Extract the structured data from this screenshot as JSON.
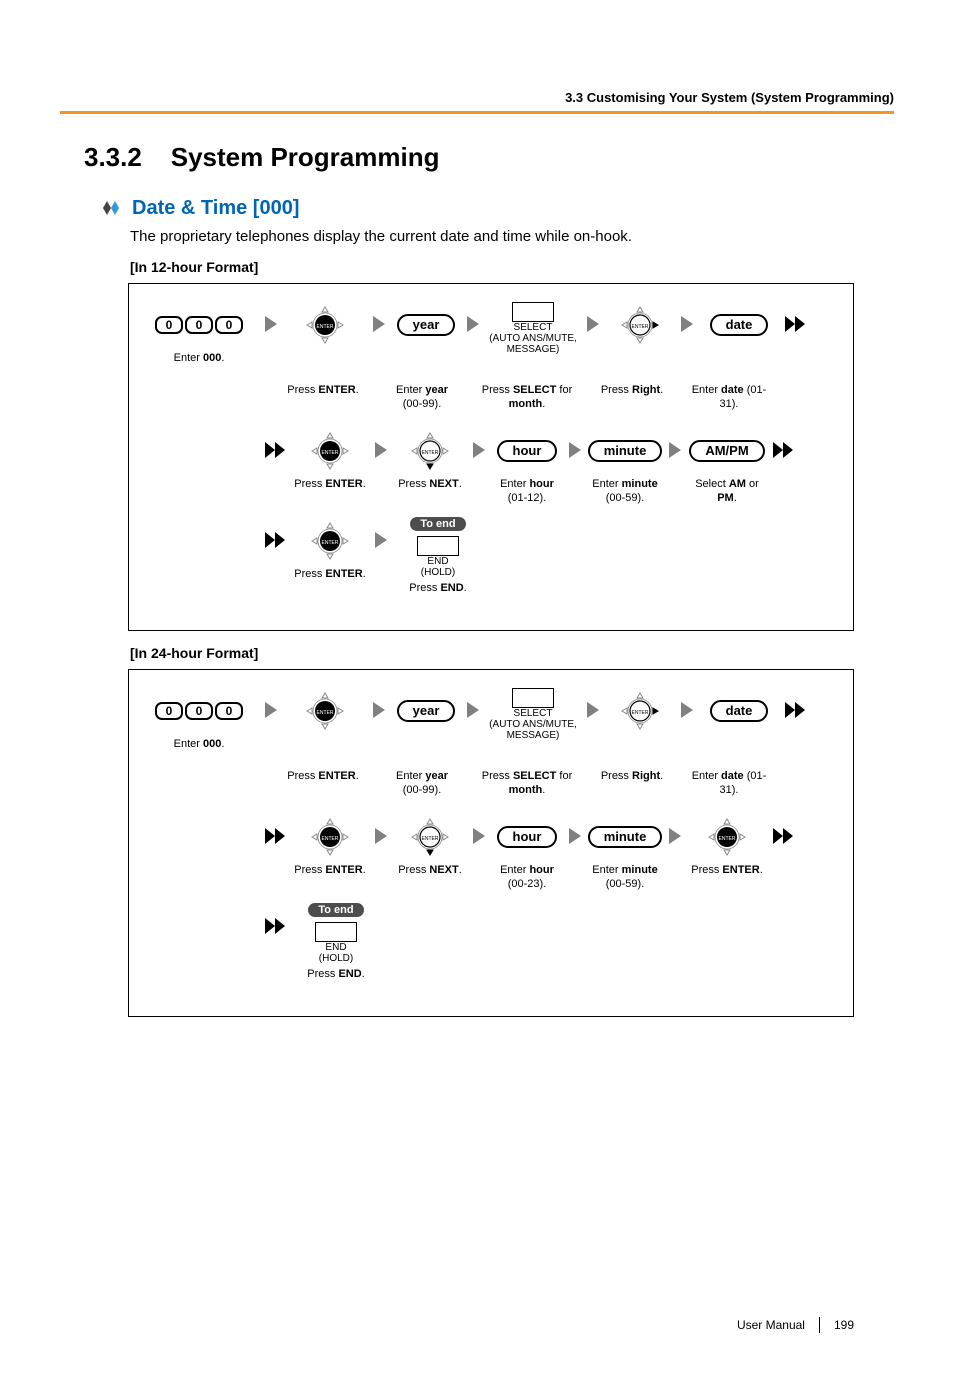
{
  "header": {
    "section_path": "3.3 Customising Your System (System Programming)"
  },
  "title": {
    "number": "3.3.2",
    "text": "System Programming"
  },
  "subhead": "Date & Time [000]",
  "intro": "The proprietary telephones display the current date and time while on-hook.",
  "format12_label": "[In 12-hour Format]",
  "format24_label": "[In 24-hour Format]",
  "common": {
    "enter3zeros_digits": [
      "0",
      "0",
      "0"
    ],
    "enter000_caption_pre": "Enter ",
    "enter000_caption_bold": "000",
    "enter000_caption_post": ".",
    "press_enter_pre": "Press ",
    "press_enter_bold": "ENTER",
    "press_enter_post": ".",
    "year_pill": "year",
    "enter_year_pre": "Enter ",
    "enter_year_bold": "year",
    "enter_year_post": " (00-99).",
    "select_label_line1": "SELECT",
    "select_label_line2": "(AUTO ANS/MUTE,",
    "select_label_line3": "MESSAGE)",
    "press_select_pre": "Press ",
    "press_select_bold": "SELECT",
    "press_select_post": " for ",
    "press_select_bold2": "month",
    "press_select_post2": ".",
    "press_right_pre": "Press ",
    "press_right_bold": "Right",
    "press_right_post": ".",
    "date_pill": "date",
    "enter_date_pre": "Enter ",
    "enter_date_bold": "date",
    "enter_date_post": " (01-31).",
    "press_next_pre": "Press ",
    "press_next_bold": "NEXT",
    "press_next_post": ".",
    "hour_pill": "hour",
    "minute_pill": "minute",
    "ampm_pill": "AM/PM",
    "enter_minute_pre": "Enter ",
    "enter_minute_bold": "minute",
    "enter_minute_post": " (00-59).",
    "select_ampm_pre": "Select ",
    "select_ampm_bold1": "AM",
    "select_ampm_mid": " or ",
    "select_ampm_bold2": "PM",
    "select_ampm_post": ".",
    "to_end": "To end",
    "end_label": "END",
    "hold_label": "(HOLD)",
    "press_end_pre": "Press ",
    "press_end_bold": "END",
    "press_end_post": "."
  },
  "hour12_caption_pre": "Enter ",
  "hour12_caption_bold": "hour",
  "hour12_caption_post": " (01-12).",
  "hour24_caption_pre": "Enter ",
  "hour24_caption_bold": "hour",
  "hour24_caption_post": " (00-23).",
  "footer": {
    "doc": "User Manual",
    "page": "199"
  }
}
